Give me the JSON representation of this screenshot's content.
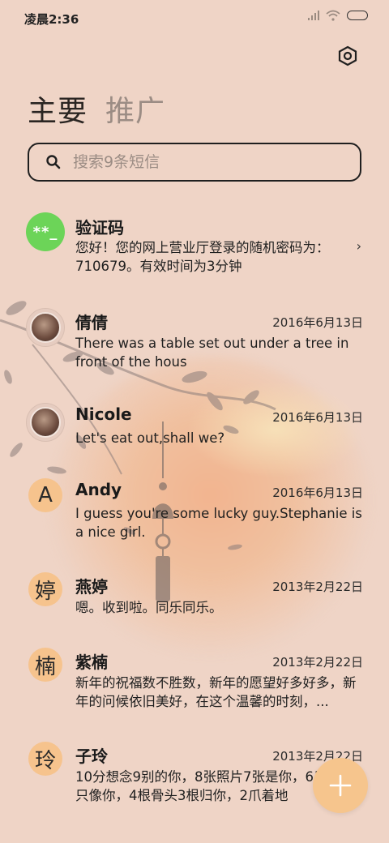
{
  "status_bar": {
    "time": "凌晨2:36"
  },
  "tabs": [
    {
      "label": "主要"
    },
    {
      "label": "推广"
    }
  ],
  "search": {
    "placeholder": "搜索9条短信"
  },
  "messages": [
    {
      "avatar_text": "**_",
      "name": "验证码",
      "date": "",
      "preview": "您好！您的网上营业厅登录的随机密码为：710679。有效时间为3分钟"
    },
    {
      "avatar_text": "",
      "name": "倩倩",
      "date": "2016年6月13日",
      "preview": "There was a table set out under a tree in front of the hous"
    },
    {
      "avatar_text": "",
      "name": "Nicole",
      "date": "2016年6月13日",
      "preview": "Let's eat out,shall we?"
    },
    {
      "avatar_text": "A",
      "name": "Andy",
      "date": "2016年6月13日",
      "preview": "I guess you're some lucky guy.Stephanie is a nice girl."
    },
    {
      "avatar_text": "婷",
      "name": "燕婷",
      "date": "2013年2月22日",
      "preview": "嗯。收到啦。同乐同乐。"
    },
    {
      "avatar_text": "楠",
      "name": "紫楠",
      "date": "2013年2月22日",
      "preview": "新年的祝福数不胜数，新年的愿望好多好多，新年的问候依旧美好，在这个温馨的时刻，..."
    },
    {
      "avatar_text": "玲",
      "name": "子玲",
      "date": "2013年2月22日",
      "preview": "10分想念9别的你，8张照片7张是你，6只小狗5只像你，4根骨头3根归你，2爪着地"
    }
  ],
  "colors": {
    "background": "#efd4c6",
    "accent_orange": "#f6c38d",
    "verification_green": "#6cd458"
  },
  "icons": {
    "settings": "hexagon-gear-icon",
    "search": "search-icon",
    "compose": "plus-icon"
  }
}
